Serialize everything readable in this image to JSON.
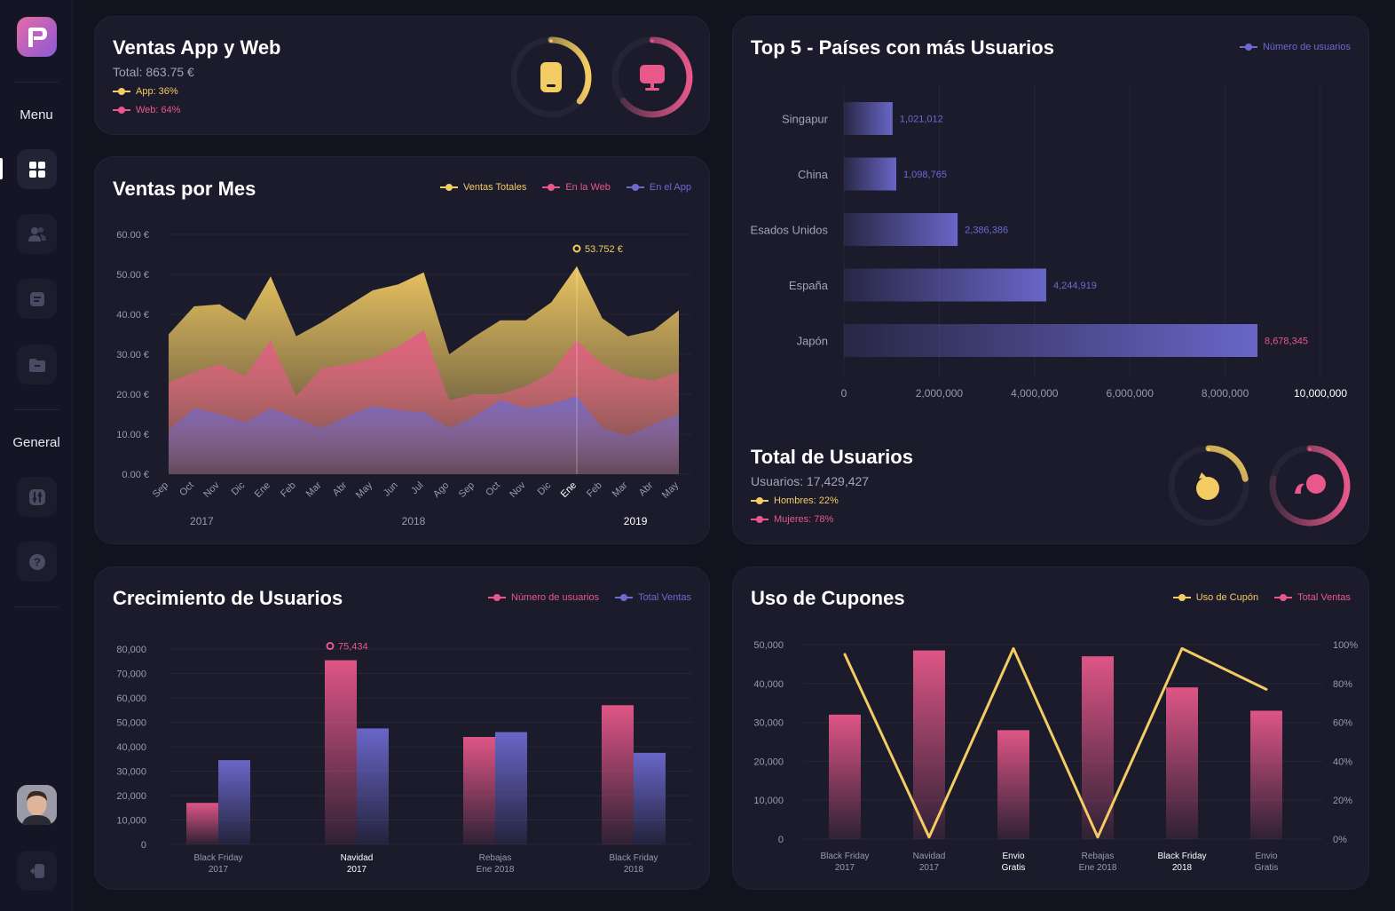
{
  "sidebar": {
    "menu_label": "Menu",
    "general_label": "General",
    "items": [
      {
        "icon": "dashboard-icon"
      },
      {
        "icon": "users-icon"
      },
      {
        "icon": "document-icon"
      },
      {
        "icon": "folder-icon"
      },
      {
        "icon": "settings-sliders-icon"
      },
      {
        "icon": "help-icon"
      },
      {
        "icon": "logout-icon"
      }
    ]
  },
  "sales_card": {
    "title": "Ventas App y Web",
    "total": "Total: 863.75 €",
    "app_label": "App: 36%",
    "web_label": "Web: 64%",
    "app_pct": 36,
    "web_pct": 64
  },
  "users_total_card": {
    "title": "Total de Usuarios",
    "total": "Usuarios: 17,429,427",
    "men_label": "Hombres: 22%",
    "women_label": "Mujeres: 78%",
    "men_pct": 22,
    "women_pct": 78
  },
  "colors": {
    "yellow": "#f3cc63",
    "pink": "#e8588a",
    "purple": "#6d6ad0",
    "bg": "#13131f",
    "card": "#1b1b2c"
  },
  "chart_data": [
    {
      "id": "monthly",
      "type": "area",
      "title": "Ventas por Mes",
      "categories": [
        "Sep",
        "Oct",
        "Nov",
        "Dic",
        "Ene",
        "Feb",
        "Mar",
        "Abr",
        "May",
        "Jun",
        "Jul",
        "Ago",
        "Sep",
        "Oct",
        "Nov",
        "Dic",
        "Ene",
        "Feb",
        "Mar",
        "Abr",
        "May"
      ],
      "year_labels": [
        "2017",
        "2018",
        "2019"
      ],
      "series": [
        {
          "name": "Ventas Totales",
          "values": [
            35,
            42,
            42.5,
            38.5,
            49.5,
            34.5,
            38,
            42,
            46,
            47.5,
            50.5,
            30,
            34.5,
            38.5,
            38.5,
            43,
            52,
            39,
            34.5,
            36,
            41
          ]
        },
        {
          "name": "En la Web",
          "values": [
            23,
            25.5,
            27.5,
            24.5,
            33.5,
            19.5,
            26.5,
            27.5,
            29,
            32,
            36,
            18.5,
            20,
            20,
            22,
            25.5,
            33.5,
            27.5,
            24.5,
            23.5,
            25.5
          ]
        },
        {
          "name": "En el App",
          "values": [
            11,
            16.5,
            15,
            13,
            16.5,
            14,
            11.5,
            14.5,
            17,
            16,
            15.5,
            11.5,
            14.5,
            18.5,
            16.5,
            17.5,
            19.5,
            11.5,
            9.5,
            12.5,
            15
          ]
        }
      ],
      "yticks": [
        "0.00 €",
        "10.00 €",
        "20.00 €",
        "30.00 €",
        "40.00 €",
        "50.00 €",
        "60.00 €"
      ],
      "ylim": [
        0,
        60
      ],
      "annotation": "53.752 €",
      "annotation_index": 16
    },
    {
      "id": "countries",
      "type": "bar",
      "title": "Top 5 - Países con más Usuarios",
      "categories": [
        "Singapur",
        "China",
        "Esados Unidos",
        "España",
        "Japón"
      ],
      "values": [
        1021012,
        1098765,
        2386386,
        4244919,
        8678345
      ],
      "value_labels": [
        "1,021,012",
        "1,098,765",
        "2,386,386",
        "4,244,919",
        "8,678,345"
      ],
      "series_name": "Número de usuarios",
      "xticks": [
        "0",
        "2,000,000",
        "4,000,000",
        "6,000,000",
        "8,000,000",
        "10,000,000"
      ],
      "xlim": [
        0,
        10000000
      ]
    },
    {
      "id": "growth",
      "type": "bar",
      "title": "Crecimiento de Usuarios",
      "categories": [
        [
          "Black Friday",
          "2017"
        ],
        [
          "Navidad",
          "2017"
        ],
        [
          "Rebajas",
          "Ene 2018"
        ],
        [
          "Black Friday",
          "2018"
        ]
      ],
      "series": [
        {
          "name": "Número de usuarios",
          "values": [
            17000,
            75434,
            44000,
            57000
          ]
        },
        {
          "name": "Total Ventas",
          "values": [
            34500,
            47500,
            46000,
            37500
          ]
        }
      ],
      "yticks": [
        "0",
        "10,000",
        "20,000",
        "30,000",
        "40,000",
        "50,000",
        "60,000",
        "70,000",
        "80,000"
      ],
      "ylim": [
        0,
        80000
      ],
      "annotation": "75,434",
      "annotation_index": 1
    },
    {
      "id": "coupons",
      "type": "bar",
      "title": "Uso de Cupones",
      "categories": [
        [
          "Black Friday",
          "2017"
        ],
        [
          "Navidad",
          "2017"
        ],
        [
          "Envio",
          "Gratis"
        ],
        [
          "Rebajas",
          "Ene 2018"
        ],
        [
          "Black Friday",
          "2018"
        ],
        [
          "Envio",
          "Gratis"
        ]
      ],
      "series": [
        {
          "name": "Total Ventas",
          "values": [
            32000,
            48500,
            28000,
            47000,
            39000,
            33000
          ]
        },
        {
          "name": "Uso de Cupón",
          "values": [
            95,
            1,
            98,
            1,
            98,
            77
          ]
        }
      ],
      "yticks_left": [
        "0",
        "10,000",
        "20,000",
        "30,000",
        "40,000",
        "50,000"
      ],
      "yticks_right": [
        "0%",
        "20%",
        "40%",
        "60%",
        "80%",
        "100%"
      ],
      "ylim": [
        0,
        50000
      ],
      "y2lim": [
        0,
        100
      ]
    }
  ]
}
